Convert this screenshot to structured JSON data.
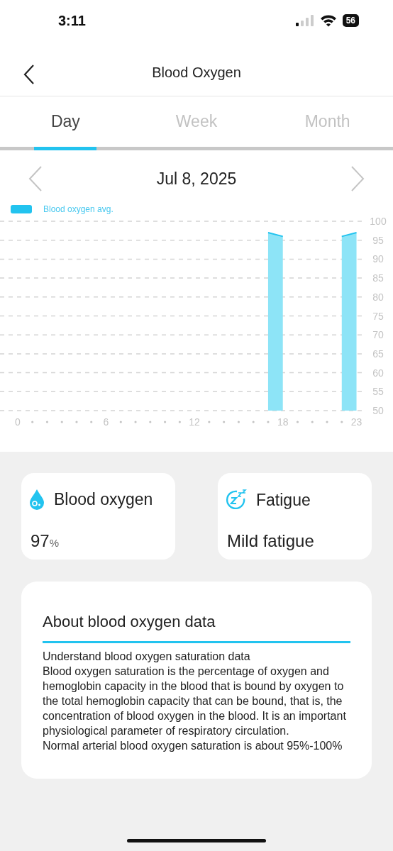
{
  "status_bar": {
    "time": "3:11",
    "battery": "56"
  },
  "header": {
    "title": "Blood Oxygen"
  },
  "tabs": [
    {
      "label": "Day",
      "selected": true
    },
    {
      "label": "Week",
      "selected": false
    },
    {
      "label": "Month",
      "selected": false
    }
  ],
  "date_nav": {
    "date": "Jul 8, 2025"
  },
  "chart": {
    "chart_data": {
      "type": "area",
      "x": [
        17,
        18,
        22,
        23
      ],
      "series": [
        {
          "name": "Blood oxygen avg.",
          "color": "#8de4f7",
          "values": [
            97,
            96,
            96,
            97
          ]
        }
      ],
      "xticks": [
        0,
        6,
        12,
        18,
        23
      ],
      "xlim": [
        -1.2,
        23.6
      ],
      "grid": true,
      "ylim": [
        50,
        100
      ],
      "yticks": [
        100,
        95,
        90,
        85,
        80,
        75,
        70,
        65,
        60,
        55,
        50
      ]
    }
  },
  "cards": [
    {
      "kind": "oxygen",
      "title": "Blood oxygen",
      "value": "97",
      "unit": "%"
    },
    {
      "kind": "fatigue",
      "title": "Fatigue",
      "value": "Mild fatigue"
    }
  ],
  "about": {
    "title": "About blood oxygen data",
    "paragraphs": [
      "Understand blood oxygen saturation data",
      "Blood oxygen saturation is the percentage of oxygen and hemoglobin capacity in the blood that is bound by oxygen to the total hemoglobin capacity that can be bound, that is, the concentration of blood oxygen in the blood. It is an important physiological parameter of respiratory circulation.",
      "Normal arterial blood oxygen saturation is about 95%-100%"
    ]
  }
}
